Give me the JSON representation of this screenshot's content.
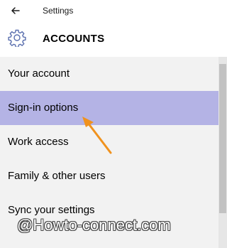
{
  "header": {
    "back_icon": "arrow-left-icon",
    "title": "Settings",
    "category_icon": "gear-icon",
    "category": "ACCOUNTS"
  },
  "menu": {
    "items": [
      {
        "label": "Your account",
        "selected": false
      },
      {
        "label": "Sign-in options",
        "selected": true
      },
      {
        "label": "Work access",
        "selected": false
      },
      {
        "label": "Family & other users",
        "selected": false
      },
      {
        "label": "Sync your settings",
        "selected": false
      }
    ]
  },
  "annotation": {
    "arrow_icon": "orange-arrow-icon",
    "color": "#f0921e"
  },
  "watermark": {
    "text": "@Howto-connect.com"
  },
  "colors": {
    "accent": "#6a7fb3",
    "selected_bg": "#b4b3e5"
  }
}
